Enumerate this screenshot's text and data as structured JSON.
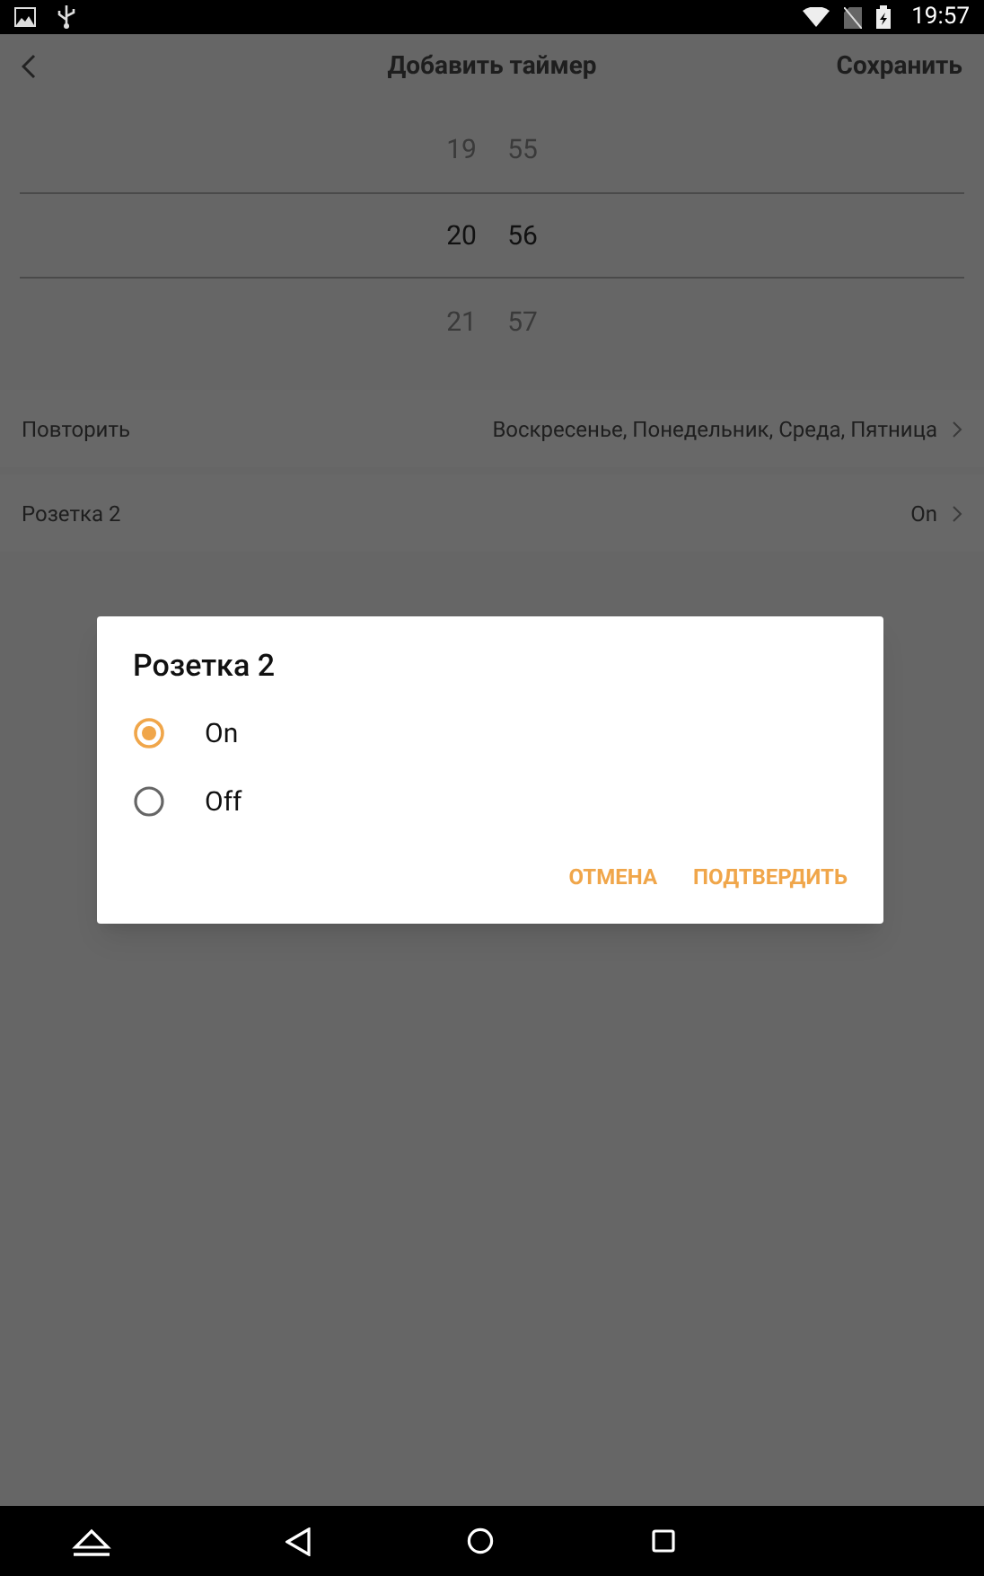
{
  "status_bar": {
    "time": "19:57"
  },
  "header": {
    "title": "Добавить таймер",
    "save": "Сохранить"
  },
  "time_picker": {
    "hours": [
      {
        "value": "19",
        "selected": false
      },
      {
        "value": "20",
        "selected": true
      },
      {
        "value": "21",
        "selected": false
      }
    ],
    "minutes": [
      {
        "value": "55",
        "selected": false
      },
      {
        "value": "56",
        "selected": true
      },
      {
        "value": "57",
        "selected": false
      }
    ]
  },
  "settings": [
    {
      "label": "Повторить",
      "value": "Воскресенье, Понедельник, Среда, Пятница"
    },
    {
      "label": "Розетка 2",
      "value": "On"
    }
  ],
  "dialog": {
    "title": "Розетка 2",
    "options": [
      {
        "label": "On",
        "selected": true
      },
      {
        "label": "Off",
        "selected": false
      }
    ],
    "buttons": [
      "ОТМЕНА",
      "ПОДТВЕРДИТЬ"
    ]
  }
}
